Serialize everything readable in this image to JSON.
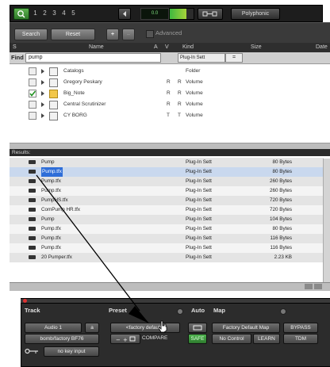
{
  "toolbar": {
    "numbers": [
      "1",
      "2",
      "3",
      "4",
      "5"
    ],
    "display_value": "0.0",
    "mode_label": "Polyphonic"
  },
  "search": {
    "search_label": "Search",
    "reset_label": "Reset",
    "advanced_label": "Advanced",
    "plus": "+",
    "minus": "–"
  },
  "columns": {
    "s": "S",
    "name": "Name",
    "a": "A",
    "v": "V",
    "kind": "Kind",
    "size": "Size",
    "date": "Date"
  },
  "find": {
    "label": "Find",
    "value": "pump",
    "kind_filter": "Plug-In Sett",
    "op": "="
  },
  "tree": [
    {
      "name": "Catalogs",
      "a": "",
      "v": "",
      "kind": "Folder",
      "checked": false
    },
    {
      "name": "Gregory Peskary",
      "a": "R",
      "v": "R",
      "kind": "Volume",
      "checked": false
    },
    {
      "name": "Big_Note",
      "a": "R",
      "v": "R",
      "kind": "Volume",
      "checked": true
    },
    {
      "name": "Central Scrutinizer",
      "a": "R",
      "v": "R",
      "kind": "Volume",
      "checked": false
    },
    {
      "name": "CY BORG",
      "a": "T",
      "v": "T",
      "kind": "Volume",
      "checked": false
    }
  ],
  "results": {
    "label": "Results:",
    "rows": [
      {
        "name": "Pump",
        "kind": "Plug-In Sett",
        "size": "80 Bytes",
        "selected": false
      },
      {
        "name": "Pump.tfx",
        "kind": "Plug-In Sett",
        "size": "80 Bytes",
        "selected": true
      },
      {
        "name": "Pump.tfx",
        "kind": "Plug-In Sett",
        "size": "260 Bytes",
        "selected": false
      },
      {
        "name": "Pump.tfx",
        "kind": "Plug-In Sett",
        "size": "260 Bytes",
        "selected": false
      },
      {
        "name": "PumpHS.tfx",
        "kind": "Plug-In Sett",
        "size": "720 Bytes",
        "selected": false
      },
      {
        "name": "ComPump HR.tfx",
        "kind": "Plug-In Sett",
        "size": "720 Bytes",
        "selected": false
      },
      {
        "name": "Pump",
        "kind": "Plug-In Sett",
        "size": "104 Bytes",
        "selected": false
      },
      {
        "name": "Pump.tfx",
        "kind": "Plug-In Sett",
        "size": "80 Bytes",
        "selected": false
      },
      {
        "name": "Pump.tfx",
        "kind": "Plug-In Sett",
        "size": "116 Bytes",
        "selected": false
      },
      {
        "name": "Pump.tfx",
        "kind": "Plug-In Sett",
        "size": "116 Bytes",
        "selected": false
      },
      {
        "name": "20 Pumper.tfx",
        "kind": "Plug-In Sett",
        "size": "2.23 KB",
        "selected": false
      }
    ]
  },
  "plugin": {
    "track_label": "Track",
    "preset_label": "Preset",
    "auto_label": "Auto",
    "map_label": "Map",
    "track_name": "Audio 1",
    "track_letter": "a",
    "plugin_name": "bomb/factory BF76",
    "preset_name": "<factory default>",
    "compare_label": "COMPARE",
    "safe_label": "SAFE",
    "factory_map_label": "Factory Default Map",
    "bypass_label": "BYPASS",
    "no_control_label": "No Control",
    "learn_label": "LEARN",
    "tdm_label": "TDM",
    "key_input_label": "no key input"
  },
  "colors": {
    "accent_green": "#3f9a36",
    "selection_blue": "#2f6ed8",
    "panel_dark": "#2c2c2c"
  }
}
